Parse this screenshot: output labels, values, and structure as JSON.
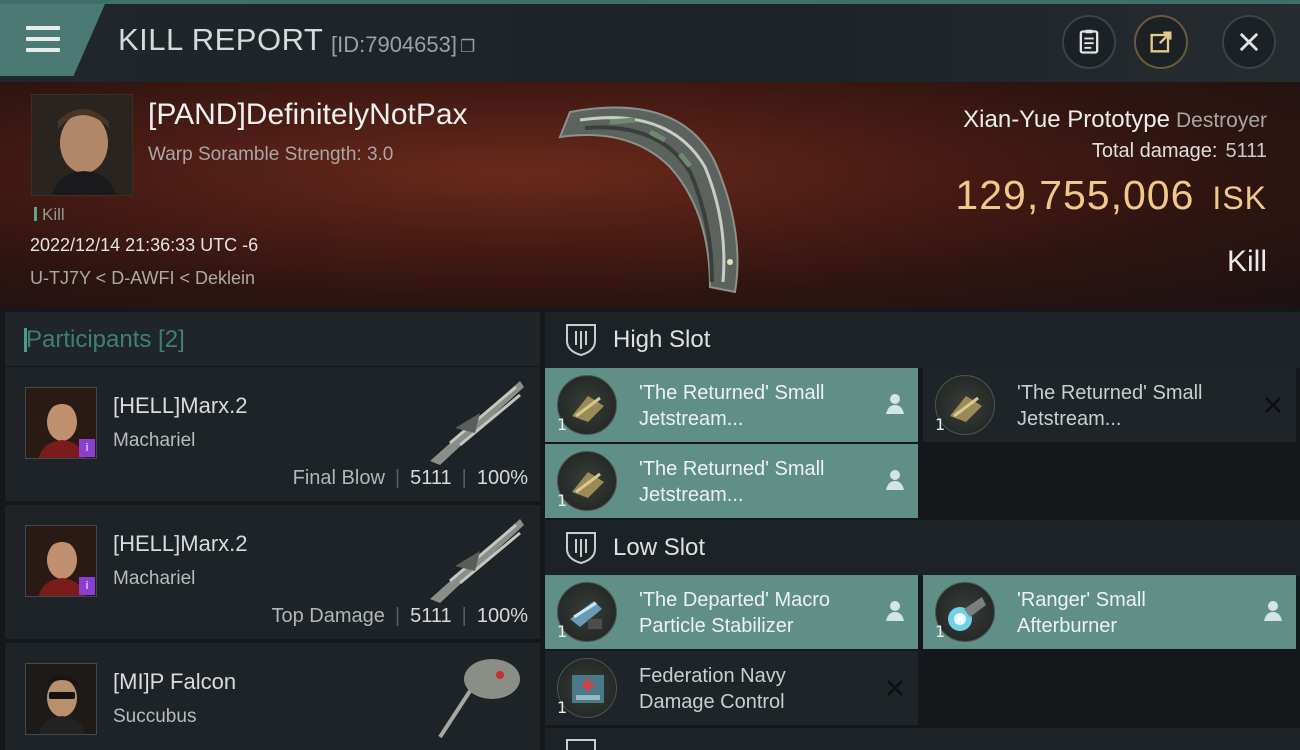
{
  "header": {
    "title": "KILL REPORT",
    "report_id": "[ID:7904653]",
    "menu_icon": "hamburger-menu-icon",
    "buttons": {
      "clipboard": "clipboard-icon",
      "share": "share-icon",
      "close": "close-icon"
    }
  },
  "victim": {
    "name": "[PAND]DefinitelyNotPax",
    "scramble": "Warp Soramble Strength: 3.0",
    "kill_tag": "Kill",
    "datetime": "2022/12/14 21:36:33 UTC -6",
    "location": "U-TJ7Y < D-AWFI < Deklein",
    "ship_name": "Xian-Yue Prototype",
    "ship_class": "Destroyer",
    "total_damage_label": "Total damage:",
    "total_damage": "5111",
    "isk_value": "129,755,006",
    "isk_unit": "ISK",
    "result": "Kill"
  },
  "participants": {
    "title": "Participants [2]",
    "rows": [
      {
        "name": "[HELL]Marx.2",
        "ship": "Machariel",
        "role": "Final Blow",
        "damage": "5111",
        "percent": "100%"
      },
      {
        "name": "[HELL]Marx.2",
        "ship": "Machariel",
        "role": "Top Damage",
        "damage": "5111",
        "percent": "100%"
      },
      {
        "name": "[MI]P Falcon",
        "ship": "Succubus",
        "role": "",
        "damage": "",
        "percent": ""
      }
    ]
  },
  "slots": {
    "high": {
      "title": "High Slot",
      "items": [
        {
          "line1": "'The Returned' Small",
          "line2": "Jetstream...",
          "qty": "1",
          "state": "on"
        },
        {
          "line1": "'The Returned' Small",
          "line2": "Jetstream...",
          "qty": "1",
          "state": "off"
        },
        {
          "line1": "'The Returned' Small",
          "line2": "Jetstream...",
          "qty": "1",
          "state": "on"
        }
      ]
    },
    "low": {
      "title": "Low Slot",
      "items": [
        {
          "line1": "'The Departed' Macro",
          "line2": "Particle Stabilizer",
          "qty": "1",
          "state": "on"
        },
        {
          "line1": "'Ranger' Small",
          "line2": "Afterburner",
          "qty": "1",
          "state": "on"
        },
        {
          "line1": "Federation Navy",
          "line2": "Damage Control",
          "qty": "1",
          "state": "off"
        }
      ]
    }
  },
  "colors": {
    "accent": "#4a7a73",
    "slot_active": "#5f8f87",
    "isk": "#f0c88a"
  }
}
